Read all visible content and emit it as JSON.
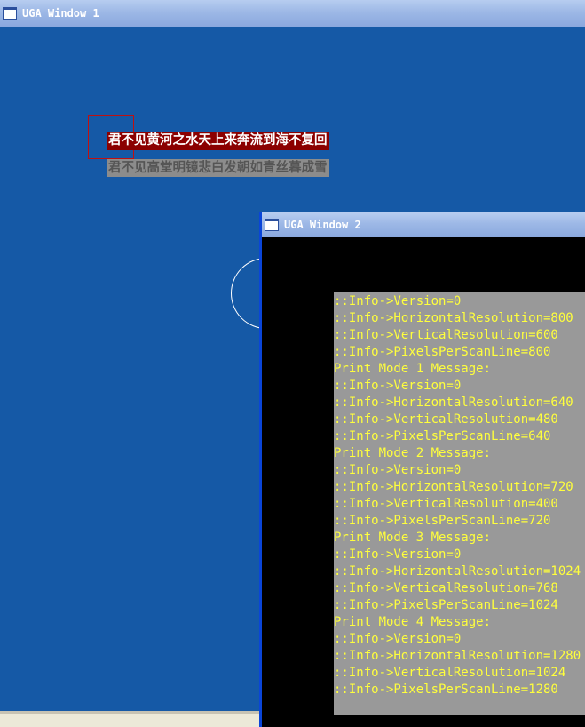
{
  "window1": {
    "title": "UGA Window 1",
    "text_line1": "君不见黄河之水天上来奔流到海不复回",
    "text_line2": "君不见高堂明镜悲白发朝如青丝暮成雪"
  },
  "window2": {
    "title": "UGA Window 2",
    "console_lines": [
      "::Info->Version=0",
      "::Info->HorizontalResolution=800",
      "::Info->VerticalResolution=600",
      "::Info->PixelsPerScanLine=800",
      "Print Mode 1 Message:",
      "::Info->Version=0",
      "::Info->HorizontalResolution=640",
      "::Info->VerticalResolution=480",
      "::Info->PixelsPerScanLine=640",
      "Print Mode 2 Message:",
      "::Info->Version=0",
      "::Info->HorizontalResolution=720",
      "::Info->VerticalResolution=400",
      "::Info->PixelsPerScanLine=720",
      "Print Mode 3 Message:",
      "::Info->Version=0",
      "::Info->HorizontalResolution=1024",
      "::Info->VerticalResolution=768",
      "::Info->PixelsPerScanLine=1024",
      "Print Mode 4 Message:",
      "::Info->Version=0",
      "::Info->HorizontalResolution=1280",
      "::Info->VerticalResolution=1024",
      "::Info->PixelsPerScanLine=1280"
    ]
  },
  "colors": {
    "desktop_blue": "#1559a6",
    "console_text": "#ffff3c",
    "console_bg": "#999999",
    "highlight_red": "#8b0000"
  }
}
